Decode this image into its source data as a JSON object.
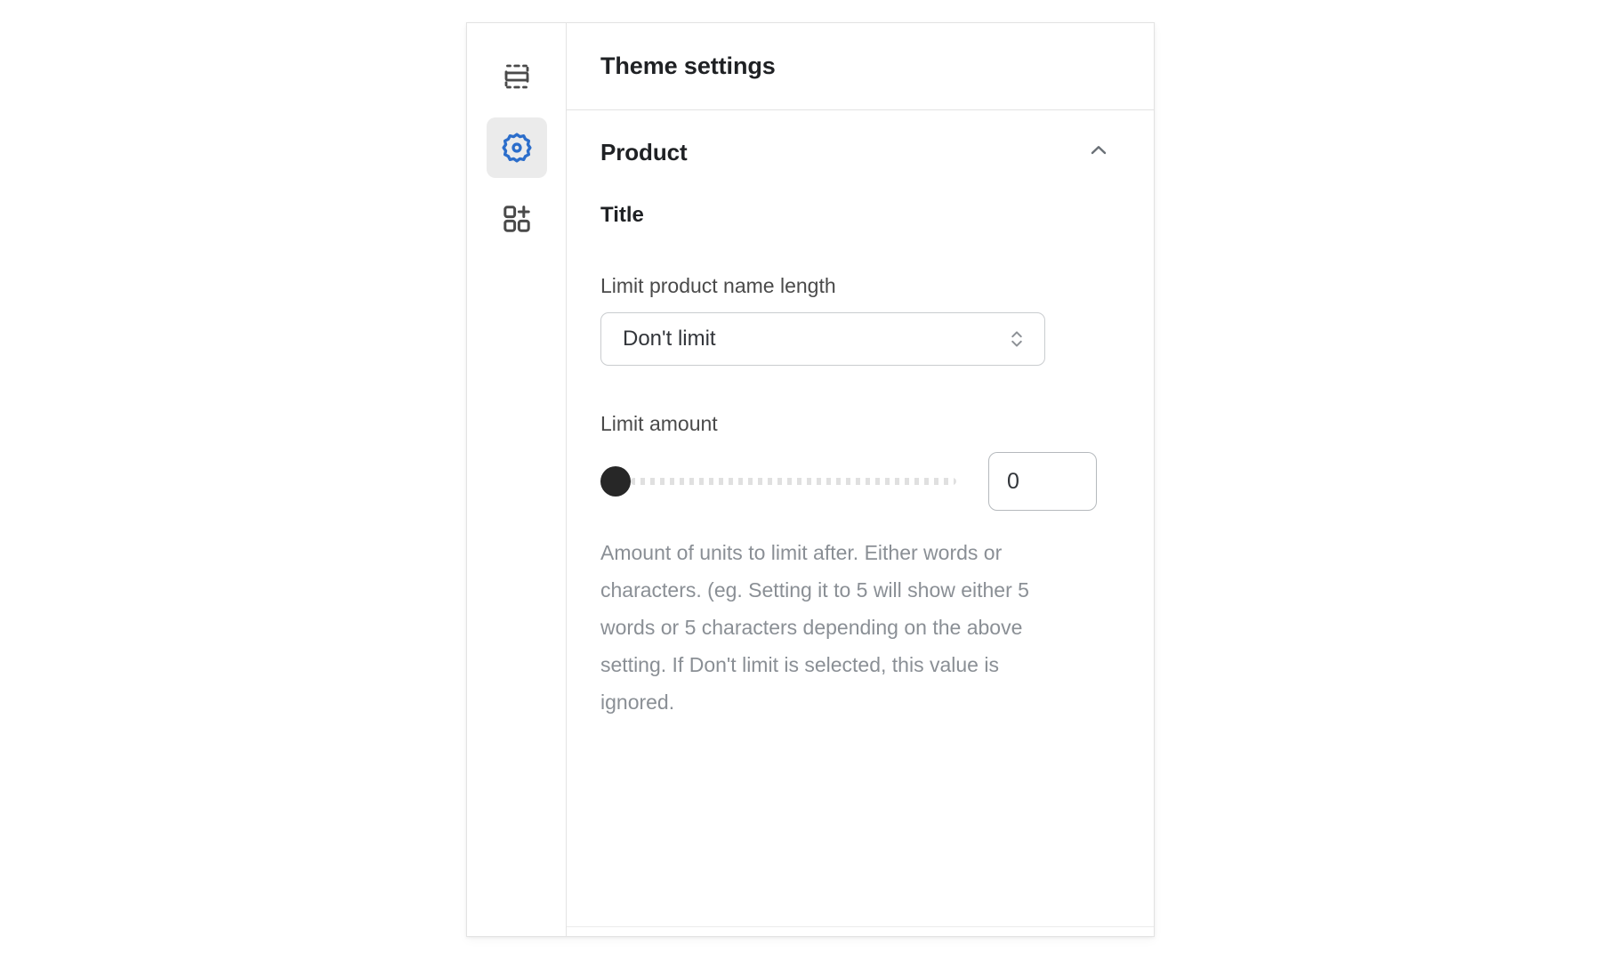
{
  "panel": {
    "header": {
      "title": "Theme settings"
    },
    "rail": {
      "items": [
        {
          "icon": "sections-icon",
          "name": "sections",
          "selected": false
        },
        {
          "icon": "gear-icon",
          "name": "theme-settings",
          "selected": true
        },
        {
          "icon": "app-blocks-add-icon",
          "name": "app-embeds",
          "selected": false
        }
      ]
    },
    "section": {
      "label": "Product",
      "collapse_icon": "chevron-up-icon",
      "expanded": true,
      "group_title": "Title",
      "fields": [
        {
          "type": "select",
          "label": "Limit product name length",
          "value": "Don't limit",
          "icon": "chevron-up-down-icon"
        },
        {
          "type": "range",
          "label": "Limit amount",
          "value": "0",
          "min": 0,
          "max": 100,
          "percent": 0,
          "help": "Amount of units to limit after. Either words or characters. (eg. Setting it to 5 will show either 5 words or 5 characters depending on the above setting. If Don't limit is selected, this value is ignored."
        }
      ]
    }
  },
  "colors": {
    "accent": "#2c6ecb",
    "selected_bg": "#ebebeb",
    "border": "#e3e3e3",
    "text": "#1f2124",
    "muted": "#8a8f95",
    "thumb": "#272727"
  }
}
